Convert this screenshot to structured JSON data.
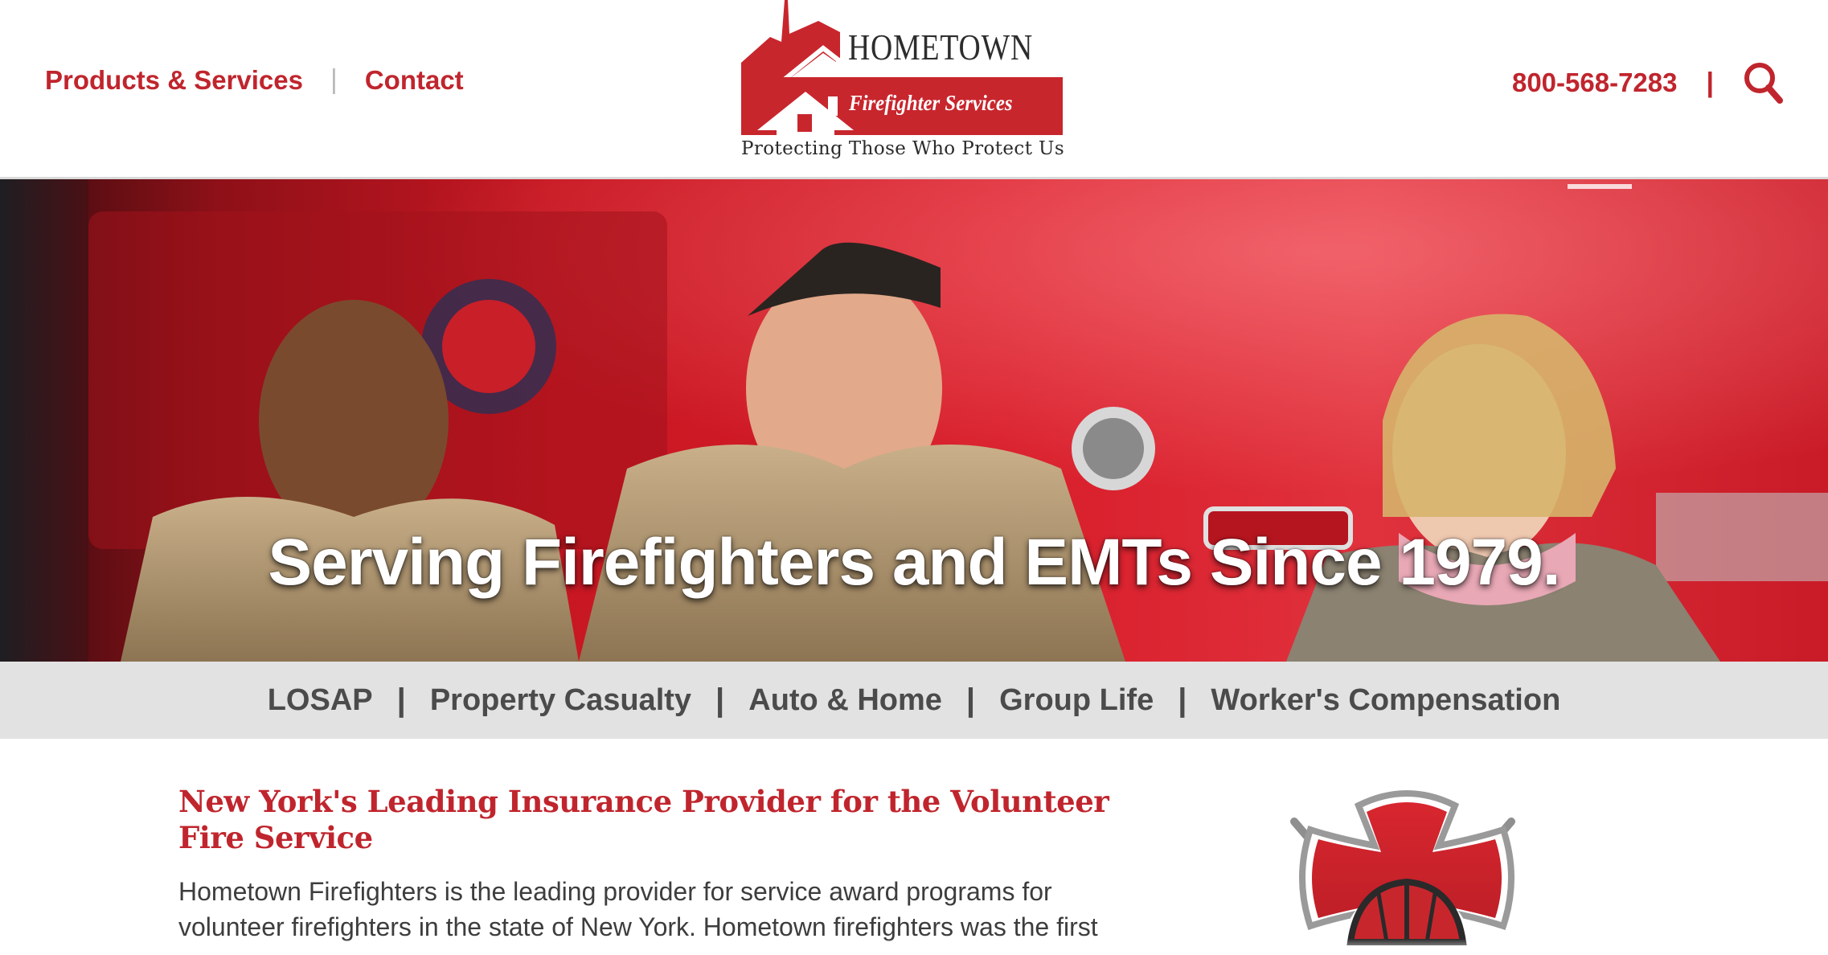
{
  "header": {
    "nav": [
      {
        "label": "Products & Services"
      },
      {
        "label": "Contact"
      }
    ],
    "nav_separator": "|",
    "logo": {
      "wordmark": "HOMETOWN",
      "sub": "Firefighter Services",
      "tagline": "Protecting Those Who Protect Us"
    },
    "phone": "800-568-7283",
    "right_separator": "|",
    "search_icon": "search-icon"
  },
  "hero": {
    "heading": "Serving Firefighters and EMTs Since 1979."
  },
  "service_bar": {
    "separator": "|",
    "items": [
      {
        "label": "LOSAP"
      },
      {
        "label": "Property Casualty"
      },
      {
        "label": "Auto & Home"
      },
      {
        "label": "Group Life"
      },
      {
        "label": "Worker's Compensation"
      }
    ]
  },
  "main": {
    "heading": "New York's Leading Insurance Provider for the Volunteer Fire Service",
    "paragraph": "Hometown Firefighters is the leading provider for service award programs for volunteer firefighters in the state of New York. Hometown firefighters was the first"
  },
  "colors": {
    "brand_red": "#c0252d",
    "service_bar_bg": "#e2e2e2",
    "service_text": "#4b4b4b",
    "body_text": "#3d3d3d"
  }
}
